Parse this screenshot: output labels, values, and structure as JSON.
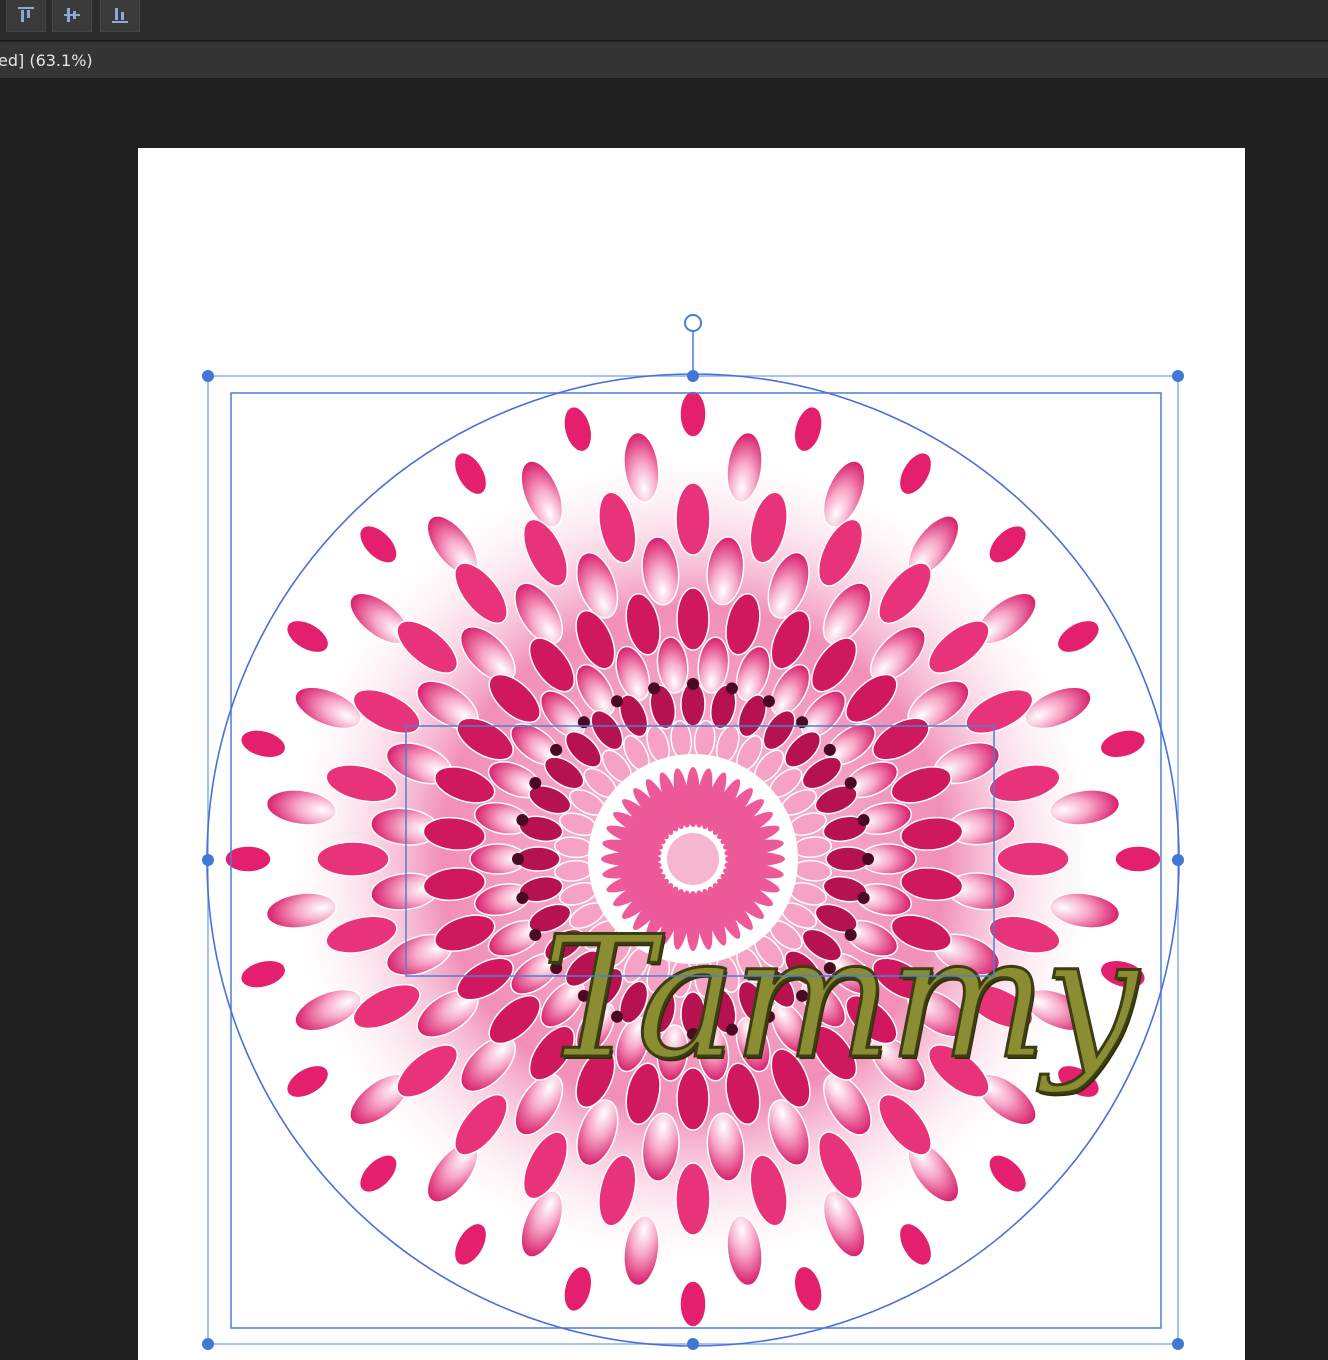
{
  "toolbar": {
    "buttons": [
      {
        "name": "align-top-icon"
      },
      {
        "name": "align-middle-icon"
      },
      {
        "name": "align-bottom-icon"
      }
    ]
  },
  "document": {
    "tab_label": "ed] (63.1%)"
  },
  "canvas": {
    "artwork_text": "Tammy"
  },
  "colors": {
    "app_background": "#202020",
    "artboard": "#ffffff",
    "selection": "#4a7fd8",
    "text_fill": "#8b8d32",
    "mandala_pink": "#e8337a"
  }
}
